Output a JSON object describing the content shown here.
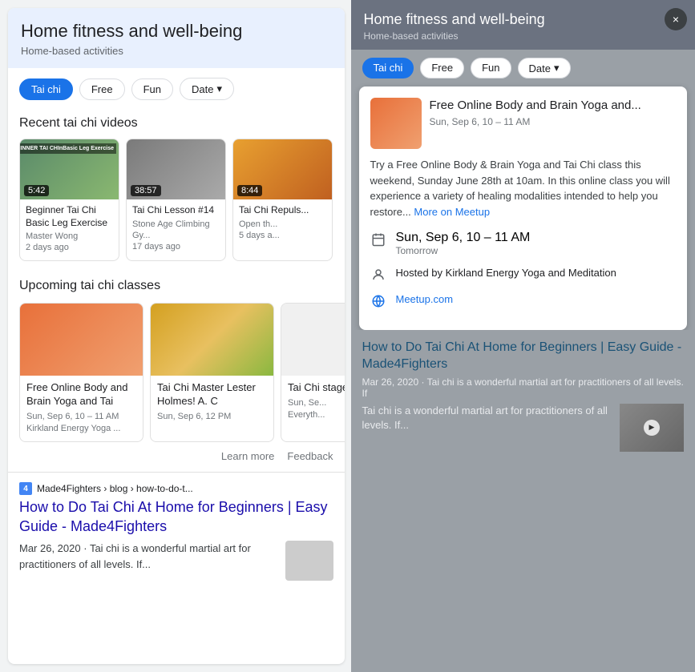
{
  "left": {
    "header": {
      "title": "Home fitness and well-being",
      "subtitle": "Home-based activities"
    },
    "filters": [
      {
        "label": "Tai chi",
        "active": true
      },
      {
        "label": "Free",
        "active": false
      },
      {
        "label": "Fun",
        "active": false
      },
      {
        "label": "Date",
        "active": false,
        "hasArrow": true
      }
    ],
    "videos_section": {
      "title": "Recent tai chi videos",
      "videos": [
        {
          "duration": "5:42",
          "title": "Beginner Tai Chi Basic Leg Exercise",
          "channel": "Master Wong",
          "age": "2 days ago"
        },
        {
          "duration": "38:57",
          "title": "Tai Chi Lesson #14",
          "channel": "Stone Age Climbing Gy...",
          "age": "17 days ago"
        },
        {
          "duration": "8:44",
          "title": "Tai Chi Repuls...",
          "channel": "Open th...",
          "age": "5 days a..."
        }
      ]
    },
    "classes_section": {
      "title": "Upcoming tai chi classes",
      "classes": [
        {
          "title": "Free Online Body and Brain Yoga and Tai",
          "date": "Sun, Sep 6, 10 – 11 AM",
          "venue": "Kirkland Energy Yoga ..."
        },
        {
          "title": "Tai Chi Master Lester Holmes! A. C",
          "date": "Sun, Sep 6, 12 PM",
          "venue": ""
        },
        {
          "title": "Tai Chi stages",
          "date": "Sun, Se...",
          "venue": "Everyth..."
        }
      ]
    },
    "actions": {
      "learn_more": "Learn more",
      "feedback": "Feedback"
    },
    "search_result": {
      "favicon_num": "4",
      "breadcrumb": "Made4Fighters › blog › how-to-do-t...",
      "title": "How to Do Tai Chi At Home for Beginners | Easy Guide - Made4Fighters",
      "date": "Mar 26, 2020",
      "snippet": "Tai chi is a wonderful martial art for practitioners of all levels. If..."
    }
  },
  "right": {
    "header": {
      "title": "Home fitness and well-being",
      "subtitle": "Home-based activities"
    },
    "close_label": "×",
    "filters": [
      {
        "label": "Tai chi",
        "active": true
      },
      {
        "label": "Free",
        "active": false
      },
      {
        "label": "Fun",
        "active": false
      },
      {
        "label": "Date",
        "active": false,
        "hasArrow": true
      }
    ],
    "event_card": {
      "title": "Free Online Body and Brain Yoga and...",
      "time": "Sun, Sep 6, 10 – 11 AM",
      "description": "Try a Free Online Body & Brain Yoga and Tai Chi class this weekend, Sunday June 28th at 10am. In this online class you will experience a variety of healing modalities intended to help you restore...",
      "more_link": "More on Meetup",
      "detail_date": "Sun, Sep 6, 10 – 11 AM",
      "detail_date_sub": "Tomorrow",
      "detail_host": "Hosted by Kirkland Energy Yoga and Meditation",
      "detail_website": "Meetup.com"
    },
    "search_result": {
      "title": "How to Do Tai Chi At Home for Beginners | Easy Guide - Made4Fighters",
      "meta": "Mar 26, 2020 · Tai chi is a wonderful martial art for practitioners of all levels. If",
      "snippet": "Tai chi is a wonderful martial art for practitioners of all levels. If..."
    }
  }
}
